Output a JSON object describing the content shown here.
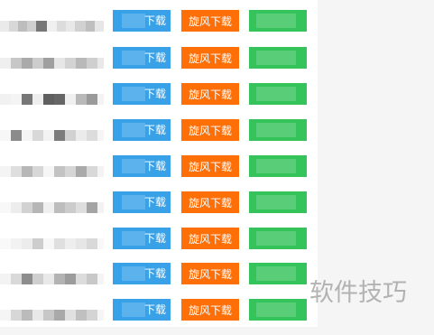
{
  "list": {
    "rows": [
      {
        "blue_label": "下载",
        "orange_label": "旋风下载",
        "green_label": ""
      },
      {
        "blue_label": "下载",
        "orange_label": "旋风下载",
        "green_label": ""
      },
      {
        "blue_label": "下载",
        "orange_label": "旋风下载",
        "green_label": ""
      },
      {
        "blue_label": "下载",
        "orange_label": "旋风下载",
        "green_label": ""
      },
      {
        "blue_label": "下载",
        "orange_label": "旋风下载",
        "green_label": ""
      },
      {
        "blue_label": "下载",
        "orange_label": "旋风下载",
        "green_label": ""
      },
      {
        "blue_label": "下载",
        "orange_label": "旋风下载",
        "green_label": ""
      },
      {
        "blue_label": "下载",
        "orange_label": "旋风下载",
        "green_label": ""
      },
      {
        "blue_label": "下载",
        "orange_label": "旋风下载",
        "green_label": ""
      }
    ]
  },
  "watermark": {
    "text": "软件技巧"
  },
  "colors": {
    "blue_button": "#39a1e8",
    "orange_button": "#ff6f08",
    "green_button": "#35c35b",
    "watermark": "#a7a7a7"
  }
}
